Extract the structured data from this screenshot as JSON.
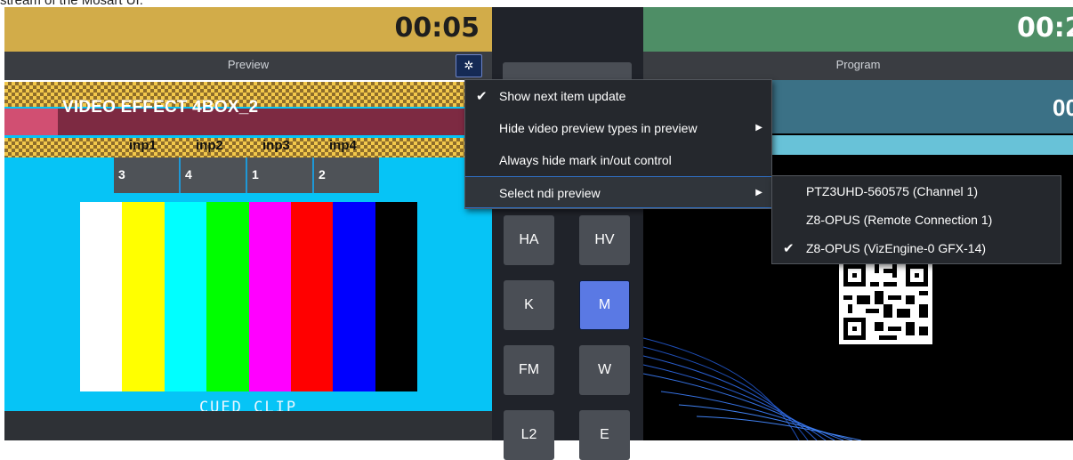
{
  "caption": "stream of the Mosart UI.",
  "preview": {
    "timer": "00:05",
    "header_label": "Preview",
    "gear_icon": "gear-icon",
    "video_effect_title": "VIDEO EFFECT 4BOX_2",
    "inputs": [
      {
        "label": "inp1",
        "value": "3"
      },
      {
        "label": "inp2",
        "value": "4"
      },
      {
        "label": "inp3",
        "value": "1"
      },
      {
        "label": "inp4",
        "value": "2"
      }
    ],
    "color_bars": [
      "#ffffff",
      "#ffff00",
      "#00ffff",
      "#00ff00",
      "#ff00ff",
      "#ff0000",
      "#0000ff",
      "#000000"
    ],
    "cued_label": "CUED CLIP"
  },
  "mid_buttons": [
    {
      "label": "HA",
      "active": false
    },
    {
      "label": "HV",
      "active": false
    },
    {
      "label": "K",
      "active": false
    },
    {
      "label": "M",
      "active": true
    },
    {
      "label": "FM",
      "active": false
    },
    {
      "label": "W",
      "active": false
    },
    {
      "label": "L2",
      "active": false
    },
    {
      "label": "E",
      "active": false
    }
  ],
  "program": {
    "timer": "00:2",
    "header_label": "Program",
    "teal_text": "00"
  },
  "context_menu": {
    "items": [
      {
        "label": "Show next item update",
        "checked": true,
        "submenu": false
      },
      {
        "label": "Hide video preview types in preview",
        "checked": false,
        "submenu": true
      },
      {
        "label": "Always hide mark in/out control",
        "checked": false,
        "submenu": false
      },
      {
        "label": "Select ndi preview",
        "checked": false,
        "submenu": true
      }
    ],
    "check_glyph": "✔",
    "arrow_glyph": "▶"
  },
  "ndi_submenu": {
    "items": [
      {
        "label": "PTZ3UHD-560575 (Channel 1)",
        "checked": false
      },
      {
        "label": "Z8-OPUS (Remote Connection 1)",
        "checked": false
      },
      {
        "label": "Z8-OPUS (VizEngine-0 GFX-14)",
        "checked": true
      }
    ]
  },
  "colors": {
    "preview_timer_bg": "#d2ac49",
    "program_timer_bg": "#4e8e66",
    "accent": "#5a79e4",
    "preview_bg": "#06c4f6"
  }
}
